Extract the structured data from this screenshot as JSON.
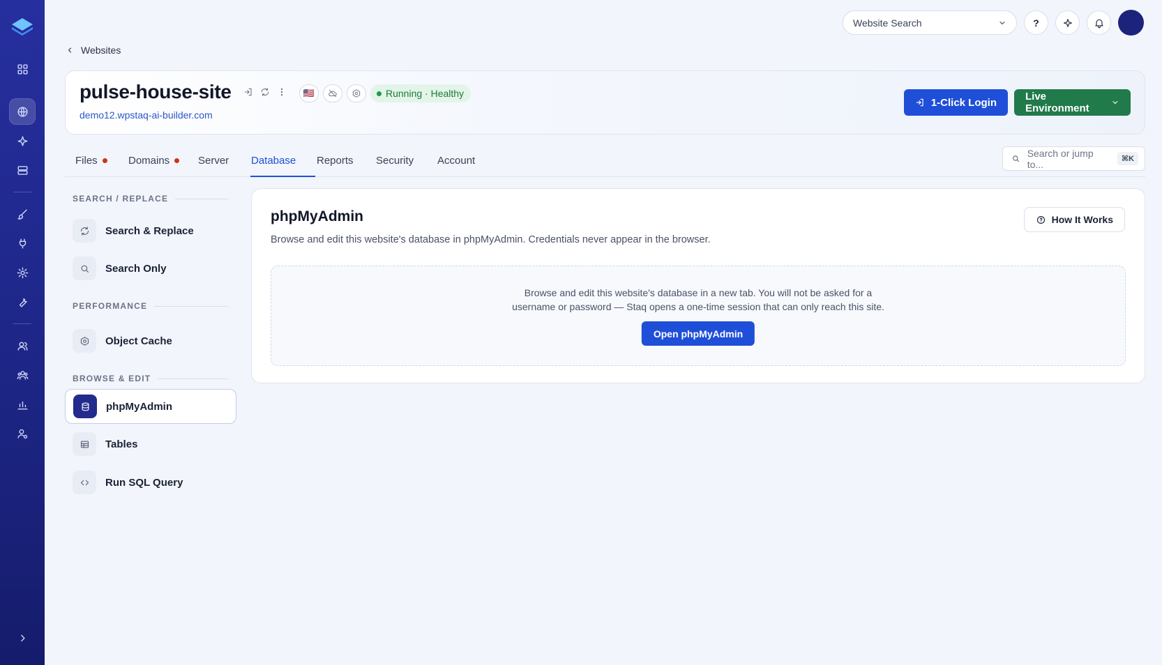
{
  "colors": {
    "brand": "#1f4fd8",
    "sidebar": "#1d2686",
    "live_env": "#217a4a",
    "healthy": "#1c7a3b",
    "tab_dot": "#c9380f"
  },
  "sidebar": {
    "items": [
      {
        "icon": "grid-icon"
      },
      {
        "icon": "globe-icon",
        "active": true
      },
      {
        "icon": "sparkle-icon"
      },
      {
        "icon": "server-icon"
      },
      {
        "icon": "brush-icon"
      },
      {
        "icon": "plug-icon"
      },
      {
        "icon": "gear-icon"
      },
      {
        "icon": "wrench-icon"
      },
      {
        "icon": "user-icon"
      },
      {
        "icon": "users-icon"
      },
      {
        "icon": "bar-chart-icon"
      },
      {
        "icon": "user-settings-icon"
      }
    ],
    "expand_icon": "chevron-right-icon"
  },
  "topbar": {
    "search_label": "Website Search",
    "help_label": "?"
  },
  "breadcrumb": {
    "label": "Websites"
  },
  "site": {
    "name": "pulse-house-site",
    "url": "demo12.wpstaq-ai-builder.com",
    "flag": "🇺🇸",
    "status": "Running · Healthy",
    "login_label": "1-Click Login",
    "env_label": "Live Environment"
  },
  "tabs": [
    {
      "label": "Files",
      "dot": true
    },
    {
      "label": "Domains",
      "dot": true
    },
    {
      "label": "Server"
    },
    {
      "label": "Database",
      "active": true
    },
    {
      "label": "Reports"
    },
    {
      "label": "Security"
    },
    {
      "label": "Account"
    }
  ],
  "jump": {
    "placeholder": "Search or jump to...",
    "shortcut": "⌘K"
  },
  "subnav": {
    "sections": [
      {
        "label": "SEARCH / REPLACE",
        "items": [
          {
            "label": "Search & Replace",
            "icon": "refresh-icon"
          },
          {
            "label": "Search Only",
            "icon": "search-icon"
          }
        ]
      },
      {
        "label": "PERFORMANCE",
        "items": [
          {
            "label": "Object Cache",
            "icon": "hexagon-icon"
          }
        ]
      },
      {
        "label": "BROWSE & EDIT",
        "items": [
          {
            "label": "phpMyAdmin",
            "icon": "database-icon",
            "active": true
          },
          {
            "label": "Tables",
            "icon": "table-icon"
          },
          {
            "label": "Run SQL Query",
            "icon": "code-icon"
          }
        ]
      }
    ]
  },
  "panel": {
    "title": "phpMyAdmin",
    "subtitle": "Browse and edit this website's database in phpMyAdmin. Credentials never appear in the browser.",
    "how_label": "How It Works",
    "box_line1": "Browse and edit this website's database in a new tab. You will not be asked for a",
    "box_line2": "username or password — Staq opens a one-time session that can only reach this site.",
    "open_label": "Open phpMyAdmin"
  }
}
